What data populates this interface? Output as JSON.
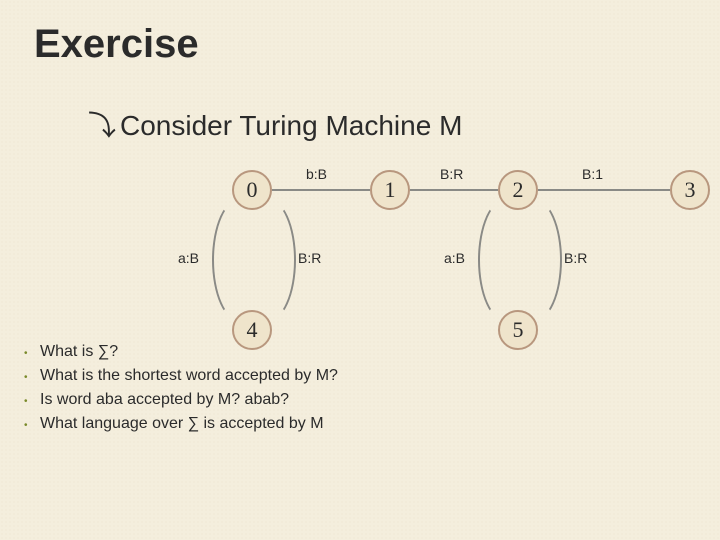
{
  "title": "Exercise",
  "subhead_swirl": "⤵",
  "subhead_text": "Consider Turing Machine M",
  "states": {
    "s0": "0",
    "s1": "1",
    "s2": "2",
    "s3": "3",
    "s4": "4",
    "s5": "5"
  },
  "transitions": {
    "t_0_1_top": "b:B",
    "t_1_2_top": "B:R",
    "t_2_3_top": "B:1",
    "t_0_4_left": "a:B",
    "t_4_0_right": "B:R",
    "t_2_5_left": "a:B",
    "t_5_2_right": "B:R"
  },
  "bullets": [
    "What is ∑?",
    "What is the shortest word accepted by M?",
    "Is word aba accepted by M? abab?",
    "What language over ∑ is accepted by M"
  ],
  "chart_data": {
    "type": "diagram",
    "kind": "turing-machine-state-diagram",
    "states": [
      "0",
      "1",
      "2",
      "3",
      "4",
      "5"
    ],
    "edges": [
      {
        "from": "0",
        "to": "1",
        "label": "b:B"
      },
      {
        "from": "1",
        "to": "2",
        "label": "B:R"
      },
      {
        "from": "2",
        "to": "3",
        "label": "B:1"
      },
      {
        "from": "0",
        "to": "4",
        "label": "a:B"
      },
      {
        "from": "4",
        "to": "0",
        "label": "B:R"
      },
      {
        "from": "2",
        "to": "5",
        "label": "a:B"
      },
      {
        "from": "5",
        "to": "2",
        "label": "B:R"
      }
    ]
  }
}
